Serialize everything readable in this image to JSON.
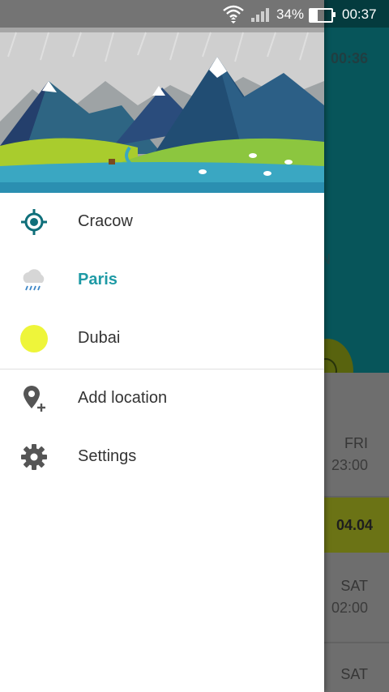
{
  "status_bar": {
    "battery_text": "34%",
    "battery_level": 0.34,
    "time": "00:37",
    "icons": [
      "wifi-icon",
      "signal-icon",
      "battery-icon"
    ]
  },
  "background": {
    "clock": "00:36",
    "partial_letter": "N",
    "rows": [
      {
        "day": "FRI",
        "time": "23:00"
      },
      {
        "date": "04.04"
      },
      {
        "day": "SAT",
        "time": "02:00"
      },
      {
        "day": "SAT"
      }
    ]
  },
  "drawer": {
    "locations": [
      {
        "label": "Cracow",
        "icon": "my-location-icon"
      },
      {
        "label": "Paris",
        "icon": "rain-cloud-icon",
        "active": true
      },
      {
        "label": "Dubai",
        "icon": "sun-icon"
      }
    ],
    "actions": [
      {
        "label": "Add location",
        "icon": "add-location-icon"
      },
      {
        "label": "Settings",
        "icon": "gear-icon"
      }
    ]
  },
  "colors": {
    "accent": "#1e9aa5",
    "teal": "#0b7a82",
    "sun": "#eef53a",
    "icon_gray": "#555555"
  }
}
